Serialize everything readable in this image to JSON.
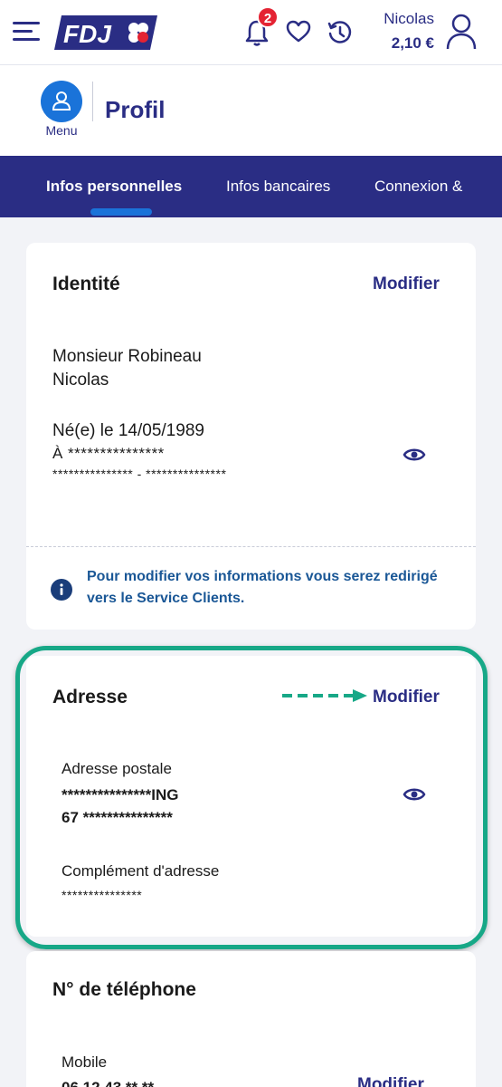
{
  "header": {
    "logo_text": "FDJ",
    "notification_count": "2",
    "user_name": "Nicolas",
    "balance": "2,10 €"
  },
  "subheader": {
    "menu_label": "Menu",
    "page_title": "Profil"
  },
  "tabs": [
    {
      "label": "Infos personnelles",
      "active": true
    },
    {
      "label": "Infos bancaires",
      "active": false
    },
    {
      "label": "Connexion &",
      "active": false
    }
  ],
  "identity": {
    "title": "Identité",
    "modify_label": "Modifier",
    "name_line1": "Monsieur Robineau",
    "name_line2": "Nicolas",
    "birth": "Né(e) le 14/05/1989",
    "birth_place": "À ***************",
    "birth_place2": "*************** - ***************",
    "info": "Pour modifier vos informations vous serez redirigé vers le Service Clients."
  },
  "address": {
    "title": "Adresse",
    "modify_label": "Modifier",
    "postal_label": "Adresse postale",
    "postal_line1": "***************ING",
    "postal_line2": "67 ***************",
    "complement_label": "Complément d'adresse",
    "complement_value": "***************"
  },
  "phone": {
    "title": "N° de téléphone",
    "mobile_label": "Mobile",
    "mobile_value": "06 12 43 ** **",
    "modify_label": "Modifier"
  },
  "colors": {
    "brand": "#2a2d84",
    "accent": "#1a73d9",
    "highlight": "#17a887",
    "badge": "#e42333"
  }
}
